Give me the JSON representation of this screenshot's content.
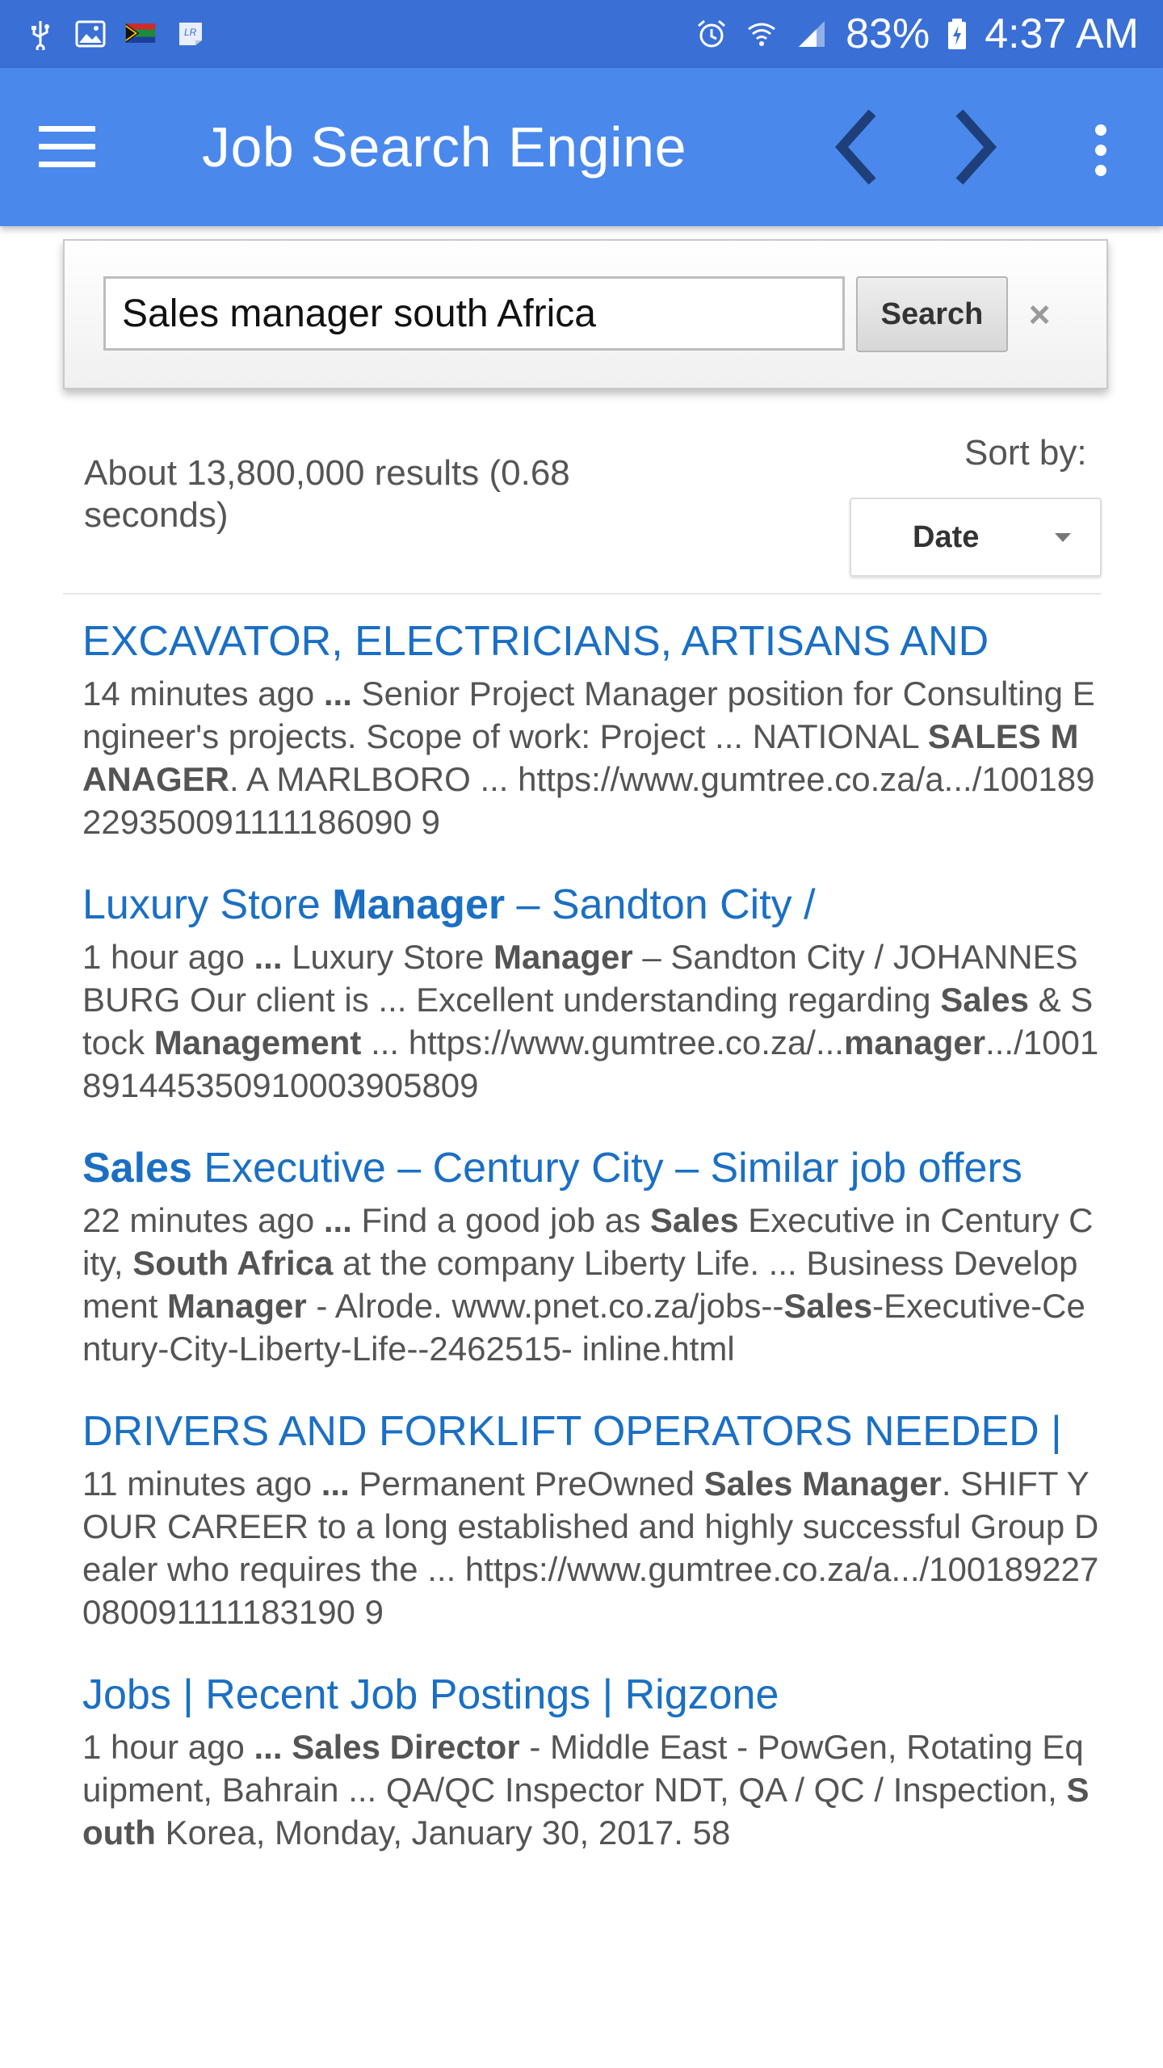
{
  "status_bar": {
    "battery": "83%",
    "time": "4:37 AM",
    "icons_left": [
      "usb-icon",
      "image-icon",
      "flag-icon",
      "note-icon"
    ],
    "icons_right": [
      "alarm-icon",
      "wifi-icon",
      "signal-icon",
      "battery-icon"
    ]
  },
  "app_bar": {
    "title": "Job Search Engine",
    "menu_icon": "hamburger-menu-icon",
    "back_icon": "chevron-left-icon",
    "forward_icon": "chevron-right-icon",
    "overflow_icon": "more-vert-icon"
  },
  "search": {
    "value": "Sales manager south Africa",
    "button_label": "Search",
    "clear_label": "×"
  },
  "results_header": {
    "stats": "About 13,800,000 results (0.68 seconds)",
    "sort_label": "Sort by:",
    "sort_value": "Date"
  },
  "colors": {
    "status_bar": "#3a6fd6",
    "app_bar": "#4a88ec",
    "link": "#1a6fc4",
    "snippet": "#545454"
  },
  "results": [
    {
      "title": [
        {
          "text": "EXCAVATOR, ELECTRICIANS, ARTISANS AND",
          "bold": false
        }
      ],
      "snippet": [
        {
          "text": "14 minutes ago ",
          "bold": false
        },
        {
          "text": "...",
          "bold": true
        },
        {
          "text": " Senior Project Manager position for Consulting Engineer's projects. Scope of work: Project ... NATIONAL ",
          "bold": false
        },
        {
          "text": "SALES MANAGER",
          "bold": true
        },
        {
          "text": ". A MARLBORO ... https://www.gumtree.co.za/a.../100189229350091111186090 9",
          "bold": false
        }
      ]
    },
    {
      "title": [
        {
          "text": "Luxury Store ",
          "bold": false
        },
        {
          "text": "Manager",
          "bold": true
        },
        {
          "text": " – Sandton City /",
          "bold": false
        }
      ],
      "snippet": [
        {
          "text": "1 hour ago ",
          "bold": false
        },
        {
          "text": "...",
          "bold": true
        },
        {
          "text": " Luxury Store ",
          "bold": false
        },
        {
          "text": "Manager",
          "bold": true
        },
        {
          "text": " – Sandton City / JOHANNESBURG Our client is ... Excellent understanding regarding ",
          "bold": false
        },
        {
          "text": "Sales",
          "bold": true
        },
        {
          "text": " & Stock ",
          "bold": false
        },
        {
          "text": "Management",
          "bold": true
        },
        {
          "text": " ... https://www.gumtree.co.za/...",
          "bold": false
        },
        {
          "text": "manager",
          "bold": true
        },
        {
          "text": ".../1001891445350910003905809",
          "bold": false
        }
      ]
    },
    {
      "title": [
        {
          "text": "Sales",
          "bold": true
        },
        {
          "text": " Executive – Century City – Similar job offers",
          "bold": false
        }
      ],
      "snippet": [
        {
          "text": "22 minutes ago ",
          "bold": false
        },
        {
          "text": "...",
          "bold": true
        },
        {
          "text": " Find a good job as ",
          "bold": false
        },
        {
          "text": "Sales",
          "bold": true
        },
        {
          "text": " Executive in Century City, ",
          "bold": false
        },
        {
          "text": "South Africa",
          "bold": true
        },
        {
          "text": " at the company Liberty Life. ... Business Development ",
          "bold": false
        },
        {
          "text": "Manager",
          "bold": true
        },
        {
          "text": " - Alrode. www.pnet.co.za/jobs--",
          "bold": false
        },
        {
          "text": "Sales",
          "bold": true
        },
        {
          "text": "-Executive-Century-City-Liberty-Life--2462515- inline.html",
          "bold": false
        }
      ]
    },
    {
      "title": [
        {
          "text": "DRIVERS AND FORKLIFT OPERATORS NEEDED |",
          "bold": false
        }
      ],
      "snippet": [
        {
          "text": "11 minutes ago ",
          "bold": false
        },
        {
          "text": "...",
          "bold": true
        },
        {
          "text": " Permanent PreOwned ",
          "bold": false
        },
        {
          "text": "Sales Manager",
          "bold": true
        },
        {
          "text": ". SHIFT YOUR CAREER to a long established and highly successful Group Dealer who requires the ... https://www.gumtree.co.za/a.../100189227080091111183190 9",
          "bold": false
        }
      ]
    },
    {
      "title": [
        {
          "text": "Jobs | Recent Job Postings | Rigzone",
          "bold": false
        }
      ],
      "snippet": [
        {
          "text": "1 hour ago ",
          "bold": false
        },
        {
          "text": "...",
          "bold": true
        },
        {
          "text": " ",
          "bold": false
        },
        {
          "text": "Sales Director",
          "bold": true
        },
        {
          "text": " - Middle East - PowGen, Rotating Equipment, Bahrain ... QA/QC Inspector NDT, QA / QC / Inspection, ",
          "bold": false
        },
        {
          "text": "South",
          "bold": true
        },
        {
          "text": " Korea, Monday, January 30, 2017. 58",
          "bold": false
        }
      ]
    }
  ]
}
